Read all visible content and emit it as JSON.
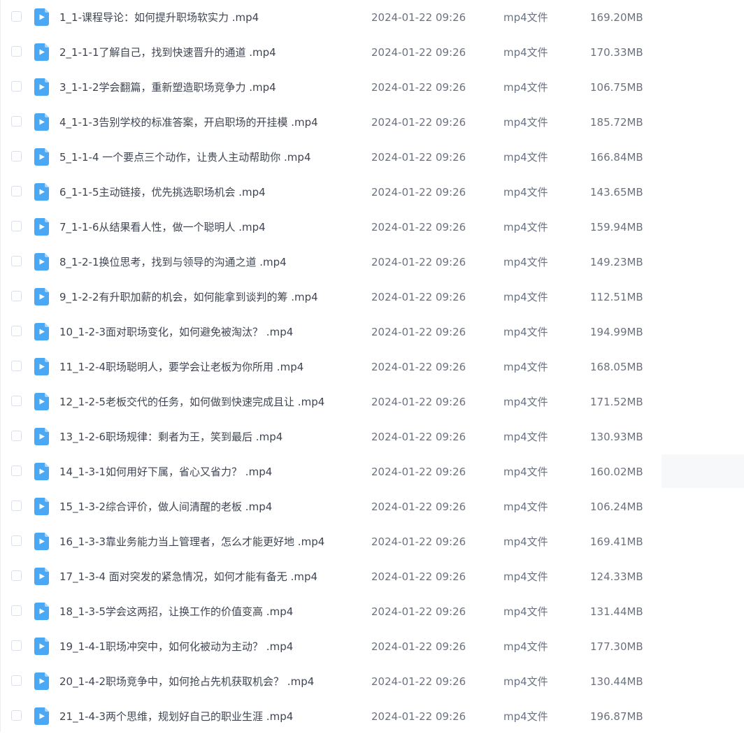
{
  "files": [
    {
      "name": "1_1-课程导论：如何提升职场软实力 .mp4",
      "date": "2024-01-22 09:26",
      "type": "mp4文件",
      "size": "169.20MB",
      "icon": "video-file-icon"
    },
    {
      "name": "2_1-1-1了解自己，找到快速晋升的通道 .mp4",
      "date": "2024-01-22 09:26",
      "type": "mp4文件",
      "size": "170.33MB",
      "icon": "video-file-icon"
    },
    {
      "name": "3_1-1-2学会翻篇，重新塑造职场竞争力 .mp4",
      "date": "2024-01-22 09:26",
      "type": "mp4文件",
      "size": "106.75MB",
      "icon": "video-file-icon"
    },
    {
      "name": "4_1-1-3告别学校的标准答案，开启职场的开挂模 .mp4",
      "date": "2024-01-22 09:26",
      "type": "mp4文件",
      "size": "185.72MB",
      "icon": "video-file-icon"
    },
    {
      "name": "5_1-1-4 一个要点三个动作，让贵人主动帮助你 .mp4",
      "date": "2024-01-22 09:26",
      "type": "mp4文件",
      "size": "166.84MB",
      "icon": "video-file-icon"
    },
    {
      "name": "6_1-1-5主动链接，优先挑选职场机会 .mp4",
      "date": "2024-01-22 09:26",
      "type": "mp4文件",
      "size": "143.65MB",
      "icon": "video-file-icon"
    },
    {
      "name": "7_1-1-6从结果看人性，做一个聪明人 .mp4",
      "date": "2024-01-22 09:26",
      "type": "mp4文件",
      "size": "159.94MB",
      "icon": "video-file-icon"
    },
    {
      "name": "8_1-2-1换位思考，找到与领导的沟通之道 .mp4",
      "date": "2024-01-22 09:26",
      "type": "mp4文件",
      "size": "149.23MB",
      "icon": "video-file-icon"
    },
    {
      "name": "9_1-2-2有升职加薪的机会，如何能拿到谈判的筹 .mp4",
      "date": "2024-01-22 09:26",
      "type": "mp4文件",
      "size": "112.51MB",
      "icon": "video-file-icon"
    },
    {
      "name": "10_1-2-3面对职场变化，如何避免被淘汰？ .mp4",
      "date": "2024-01-22 09:26",
      "type": "mp4文件",
      "size": "194.99MB",
      "icon": "video-file-icon"
    },
    {
      "name": "11_1-2-4职场聪明人，要学会让老板为你所用 .mp4",
      "date": "2024-01-22 09:26",
      "type": "mp4文件",
      "size": "168.05MB",
      "icon": "video-file-icon"
    },
    {
      "name": "12_1-2-5老板交代的任务，如何做到快速完成且让 .mp4",
      "date": "2024-01-22 09:26",
      "type": "mp4文件",
      "size": "171.52MB",
      "icon": "video-file-icon"
    },
    {
      "name": "13_1-2-6职场规律：剩者为王，笑到最后 .mp4",
      "date": "2024-01-22 09:26",
      "type": "mp4文件",
      "size": "130.93MB",
      "icon": "video-file-icon"
    },
    {
      "name": "14_1-3-1如何用好下属，省心又省力？ .mp4",
      "date": "2024-01-22 09:26",
      "type": "mp4文件",
      "size": "160.02MB",
      "icon": "video-file-icon"
    },
    {
      "name": "15_1-3-2综合评价，做人间清醒的老板 .mp4",
      "date": "2024-01-22 09:26",
      "type": "mp4文件",
      "size": "106.24MB",
      "icon": "video-file-icon"
    },
    {
      "name": "16_1-3-3靠业务能力当上管理者，怎么才能更好地 .mp4",
      "date": "2024-01-22 09:26",
      "type": "mp4文件",
      "size": "169.41MB",
      "icon": "video-file-icon"
    },
    {
      "name": "17_1-3-4 面对突发的紧急情况，如何才能有备无 .mp4",
      "date": "2024-01-22 09:26",
      "type": "mp4文件",
      "size": "124.33MB",
      "icon": "video-file-icon"
    },
    {
      "name": "18_1-3-5学会这两招，让换工作的价值变高 .mp4",
      "date": "2024-01-22 09:26",
      "type": "mp4文件",
      "size": "131.44MB",
      "icon": "video-file-icon"
    },
    {
      "name": "19_1-4-1职场冲突中，如何化被动为主动？ .mp4",
      "date": "2024-01-22 09:26",
      "type": "mp4文件",
      "size": "177.30MB",
      "icon": "video-file-icon"
    },
    {
      "name": "20_1-4-2职场竞争中，如何抢占先机获取机会？ .mp4",
      "date": "2024-01-22 09:26",
      "type": "mp4文件",
      "size": "130.44MB",
      "icon": "video-file-icon"
    },
    {
      "name": "21_1-4-3两个思维，规划好自己的职业生涯 .mp4",
      "date": "2024-01-22 09:26",
      "type": "mp4文件",
      "size": "196.87MB",
      "icon": "video-file-icon"
    }
  ],
  "colors": {
    "icon_blue": "#4aa8f5",
    "icon_fold": "#a9d6fb",
    "text_primary": "#3f4552",
    "text_secondary": "#6b7280",
    "checkbox_border": "#dcdfe5",
    "hover_bg": "#f7f8fa"
  }
}
